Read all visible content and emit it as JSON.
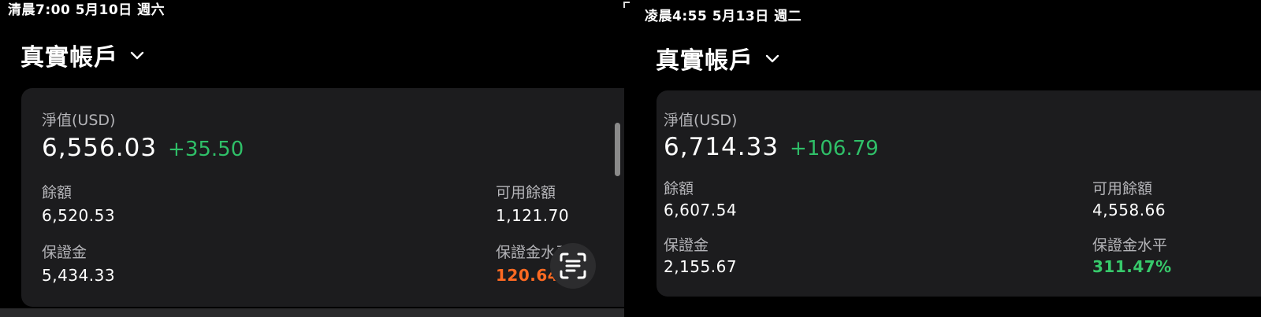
{
  "left": {
    "status_time": "清晨7:00   5月10日 週六",
    "account_title": "真實帳戶",
    "equity_label": "淨值(USD)",
    "equity_value": "6,556.03",
    "equity_change": "+35.50",
    "balance_label": "餘額",
    "balance_value": "6,520.53",
    "available_label": "可用餘額",
    "available_value": "1,121.70",
    "margin_label": "保證金",
    "margin_value": "5,434.33",
    "margin_level_label": "保證金水平",
    "margin_level_value": "120.64",
    "margin_level_color": "#ff6a22"
  },
  "right": {
    "status_time": "凌晨4:55   5月13日 週二",
    "account_title": "真實帳戶",
    "equity_label": "淨值(USD)",
    "equity_value": "6,714.33",
    "equity_change": "+106.79",
    "balance_label": "餘額",
    "balance_value": "6,607.54",
    "available_label": "可用餘額",
    "available_value": "4,558.66",
    "margin_label": "保證金",
    "margin_value": "2,155.67",
    "margin_level_label": "保證金水平",
    "margin_level_value": "311.47%",
    "margin_level_color": "#37c96b"
  },
  "icons": {
    "account_dropdown": "chevron-down-icon",
    "scan": "scan-text-icon"
  },
  "colors": {
    "positive_change": "#2fbf68",
    "card_background": "#1c1c1e"
  }
}
